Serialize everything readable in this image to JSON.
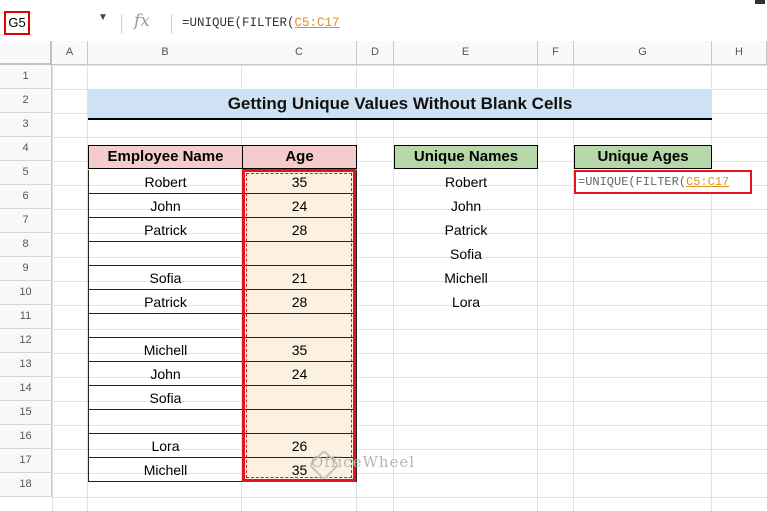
{
  "formula_bar": {
    "name_box": "G5",
    "fx_label": "fx",
    "formula_prefix": "=UNIQUE(FILTER(",
    "formula_ref": "C5:C17"
  },
  "columns": [
    "A",
    "B",
    "C",
    "D",
    "E",
    "F",
    "G",
    "H"
  ],
  "rows": [
    "1",
    "2",
    "3",
    "4",
    "5",
    "6",
    "7",
    "8",
    "9",
    "10",
    "11",
    "12",
    "13",
    "14",
    "15",
    "16",
    "17",
    "18"
  ],
  "sheet": {
    "title": "Getting Unique Values Without Blank Cells",
    "table": {
      "headers": [
        "Employee Name",
        "Age"
      ],
      "names": [
        "Robert",
        "John",
        "Patrick",
        "",
        "Sofia",
        "Patrick",
        "",
        "Michell",
        "John",
        "Sofia",
        "",
        "Lora",
        "Michell"
      ],
      "ages": [
        "35",
        "24",
        "28",
        "",
        "21",
        "28",
        "",
        "35",
        "24",
        "",
        "",
        "26",
        "35"
      ]
    },
    "unique_names": {
      "header": "Unique Names",
      "values": [
        "Robert",
        "John",
        "Patrick",
        "Sofia",
        "Michell",
        "Lora"
      ]
    },
    "unique_ages": {
      "header": "Unique Ages",
      "editing_prefix": "=UNIQUE(FILTER(",
      "editing_ref": "C5:C17"
    }
  },
  "watermark": "OfficeWheel",
  "colors": {
    "title_fill": "#cfe2f3",
    "pink_header": "#f4cccc",
    "green_header": "#b6d7a8",
    "age_fill": "#fcf0e1",
    "highlight": "#e3141c",
    "ref_orange": "#e48f1a"
  }
}
